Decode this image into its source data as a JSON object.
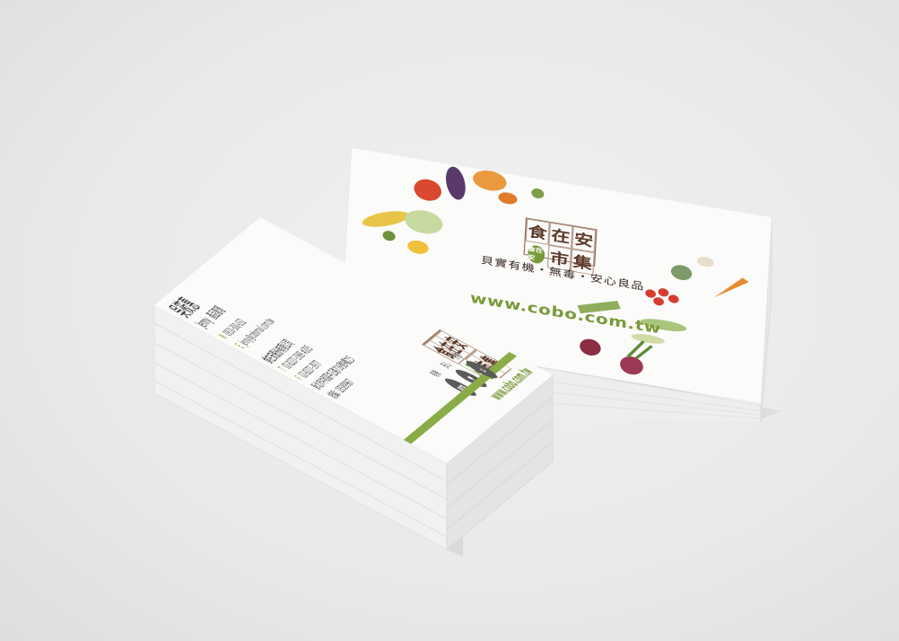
{
  "back_card": {
    "brand": {
      "c1": "食",
      "c2": "在",
      "c3": "安",
      "c5": "市",
      "c6": "集",
      "seal": "食在安"
    },
    "tagline": "貝實有機・無毒・安心良品",
    "url": "www.cobo.com.tw"
  },
  "front_card": {
    "name": "吳筱惠",
    "english_name": "Jenny",
    "job_title": "產品管理",
    "mobile_label": "M",
    "mobile": "0910-300-032",
    "email_label": "E",
    "email": "jenny@cobomail.com.tw",
    "company": "食在安股份有限公司",
    "tel_label": "T",
    "tel": "02-8227-3369 #205",
    "fax_label": "F",
    "fax": "02-8227-3977",
    "address": "新北市中和區中正路716號9樓之5",
    "tax_id": "統編：28389967",
    "url": "www.cobo.com.tw",
    "brand": {
      "c1": "食",
      "c2": "在",
      "c3": "安",
      "c5": "市",
      "c6": "集",
      "seal": "食在安"
    },
    "badges": [
      {
        "label": "有機",
        "icon": "org"
      },
      {
        "label": "安心",
        "icon": "♥"
      },
      {
        "label": "好物",
        "icon": "⌂"
      }
    ]
  },
  "colors": {
    "brand_green": "#7a9a3a",
    "brand_brown": "#5e3b2a",
    "card_white": "#fbfbfa",
    "background": "#e9e9e9"
  }
}
